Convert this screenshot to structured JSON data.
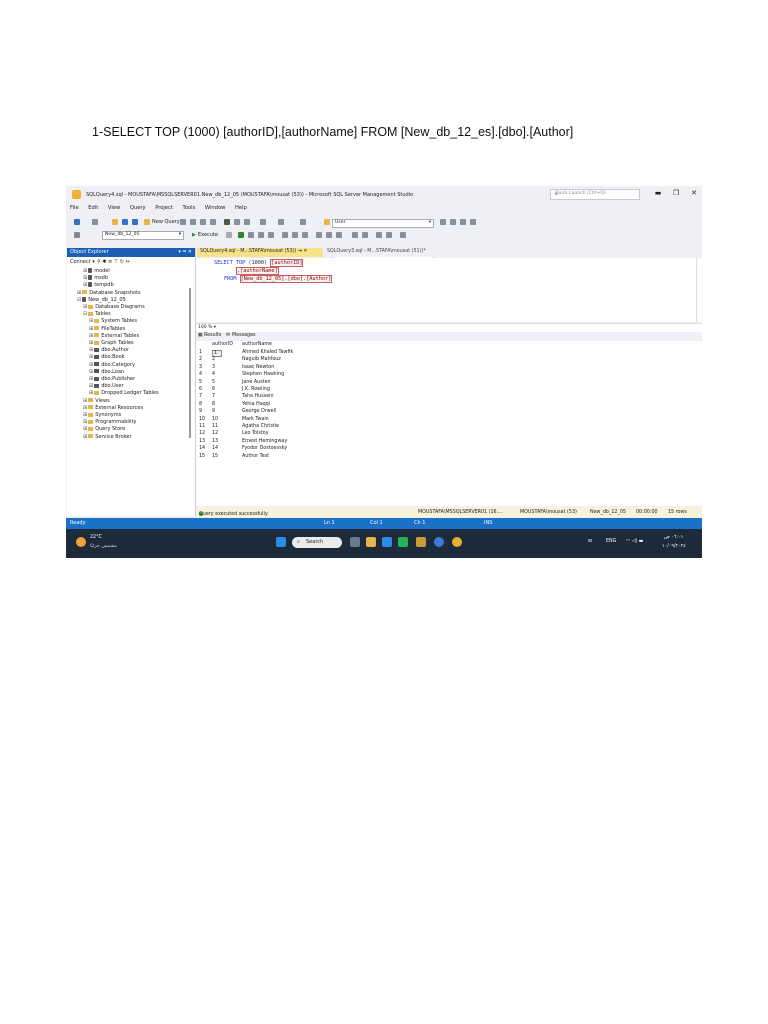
{
  "caption": "1-SELECT TOP (1000) [authorID],[authorName] FROM [New_db_12_es].[dbo].[Author]",
  "window": {
    "title": "SQLQuery4.sql - MOUSTAFA\\MSSQLSERVER01.New_db_12_05 (MOUSTAFA\\mousat (53)) - Microsoft SQL Server Management Studio",
    "quick_launch_placeholder": "Quick Launch (Ctrl+Q)",
    "minimize": "▬",
    "restore": "❐",
    "close": "✕"
  },
  "menu": [
    "File",
    "Edit",
    "View",
    "Query",
    "Project",
    "Tools",
    "Window",
    "Help"
  ],
  "toolbar": {
    "new_query": "New Query",
    "user_combo": "User",
    "db_combo": "New_db_12_05",
    "execute": "Execute"
  },
  "object_explorer": {
    "header": "Object Explorer",
    "pin": "▾ ⫤ ✕",
    "connect": "Connect ▾",
    "tools": "⚲ ✱ ≡ ⊤ ↻ ↔",
    "nodes": [
      {
        "label": "model",
        "level": 3,
        "kind": "db"
      },
      {
        "label": "msdb",
        "level": 3,
        "kind": "db"
      },
      {
        "label": "tempdb",
        "level": 3,
        "kind": "db"
      },
      {
        "label": "Database Snapshots",
        "level": 2,
        "kind": "folder"
      },
      {
        "label": "New_db_12_05",
        "level": 2,
        "kind": "db",
        "expanded": true
      },
      {
        "label": "Database Diagrams",
        "level": 3,
        "kind": "folder"
      },
      {
        "label": "Tables",
        "level": 3,
        "kind": "folder",
        "expanded": true
      },
      {
        "label": "System Tables",
        "level": 4,
        "kind": "folder"
      },
      {
        "label": "FileTables",
        "level": 4,
        "kind": "folder"
      },
      {
        "label": "External Tables",
        "level": 4,
        "kind": "folder"
      },
      {
        "label": "Graph Tables",
        "level": 4,
        "kind": "folder"
      },
      {
        "label": "dbo.Author",
        "level": 4,
        "kind": "table"
      },
      {
        "label": "dbo.Book",
        "level": 4,
        "kind": "table"
      },
      {
        "label": "dbo.Category",
        "level": 4,
        "kind": "table"
      },
      {
        "label": "dbo.Loan",
        "level": 4,
        "kind": "table"
      },
      {
        "label": "dbo.Publisher",
        "level": 4,
        "kind": "table"
      },
      {
        "label": "dbo.User",
        "level": 4,
        "kind": "table"
      },
      {
        "label": "Dropped Ledger Tables",
        "level": 4,
        "kind": "folder"
      },
      {
        "label": "Views",
        "level": 3,
        "kind": "folder"
      },
      {
        "label": "External Resources",
        "level": 3,
        "kind": "folder"
      },
      {
        "label": "Synonyms",
        "level": 3,
        "kind": "folder"
      },
      {
        "label": "Programmability",
        "level": 3,
        "kind": "folder"
      },
      {
        "label": "Query Store",
        "level": 3,
        "kind": "folder"
      },
      {
        "label": "Service Broker",
        "level": 3,
        "kind": "folder"
      }
    ]
  },
  "tabs": {
    "active": "SQLQuery4.sql - M...STAFA\\mousat (53))  ⇥ ✕",
    "inactive": "SQLQuery3.sql - M...STAFA\\mousat (51))*"
  },
  "editor": {
    "line1_kw": "SELECT TOP (",
    "line1_num": "1000",
    "line1_end": ") ",
    "line1_col": "[authorID]",
    "line2_col": ",[authorName]",
    "line3_kw": "FROM ",
    "line3_obj": "[New_db_12_05].[dbo].[Author]"
  },
  "zoom": "100 %  ▾",
  "result_tabs": {
    "results": "Results",
    "messages": "Messages"
  },
  "grid": {
    "columns": [
      "authorID",
      "authorName"
    ],
    "rows": [
      [
        "1",
        "1",
        "Ahmed Khaled Tawfik"
      ],
      [
        "2",
        "2",
        "Naguib Mahfouz"
      ],
      [
        "3",
        "3",
        "Isaac Newton"
      ],
      [
        "4",
        "4",
        "Stephen Hawking"
      ],
      [
        "5",
        "5",
        "Jane Austen"
      ],
      [
        "6",
        "6",
        "J.K. Rowling"
      ],
      [
        "7",
        "7",
        "Taha Hussein"
      ],
      [
        "8",
        "8",
        "Yehia Haqqi"
      ],
      [
        "9",
        "9",
        "George Orwell"
      ],
      [
        "10",
        "10",
        "Mark Twain"
      ],
      [
        "11",
        "11",
        "Agatha Christie"
      ],
      [
        "12",
        "12",
        "Leo Tolstoy"
      ],
      [
        "13",
        "13",
        "Ernest Hemingway"
      ],
      [
        "14",
        "14",
        "Fyodor Dostoevsky"
      ],
      [
        "15",
        "15",
        "Author Test"
      ]
    ]
  },
  "status": {
    "message": "Query executed successfully.",
    "server": "MOUSTAFA\\MSSQLSERVER01 (16....",
    "user": "MOUSTAFA\\mousat (53)",
    "db": "New_db_12_05",
    "time": "00:00:00",
    "rows": "15 rows"
  },
  "bluebar": {
    "ready": "Ready",
    "ln": "Ln 1",
    "col": "Col 1",
    "ch": "Ch 1",
    "ins": "INS"
  },
  "taskbar": {
    "temp": "22°C",
    "weather": "مشمس جزئيًا",
    "search": "Search",
    "lang": "ENG",
    "clock_time": "٠٦:٠١ ص",
    "clock_date": "١٠/٠٩/٢٠٢٤"
  },
  "colors": {
    "accent": "#1a72c8",
    "tab_active": "#f7e28c",
    "keyword": "#1a2ad6",
    "object": "#8b0000"
  }
}
